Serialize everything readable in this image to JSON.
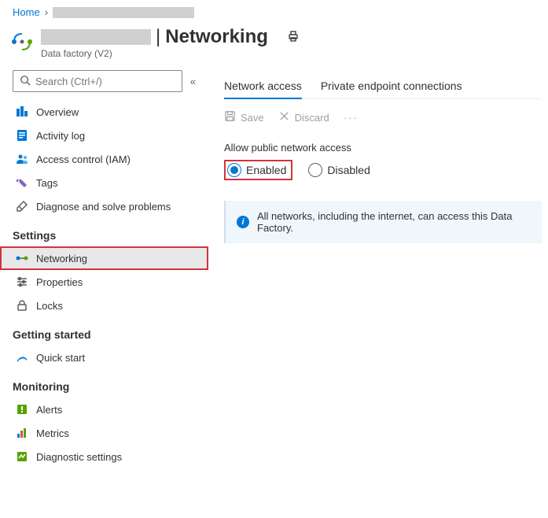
{
  "breadcrumb": {
    "home": "Home"
  },
  "header": {
    "title": "Networking",
    "subtitle": "Data factory (V2)"
  },
  "search": {
    "placeholder": "Search (Ctrl+/)"
  },
  "nav": {
    "overview": "Overview",
    "activity_log": "Activity log",
    "access_control": "Access control (IAM)",
    "tags": "Tags",
    "diagnose": "Diagnose and solve problems",
    "section_settings": "Settings",
    "networking": "Networking",
    "properties": "Properties",
    "locks": "Locks",
    "section_getting_started": "Getting started",
    "quick_start": "Quick start",
    "section_monitoring": "Monitoring",
    "alerts": "Alerts",
    "metrics": "Metrics",
    "diagnostic_settings": "Diagnostic settings"
  },
  "tabs": {
    "network_access": "Network access",
    "private_endpoint": "Private endpoint connections"
  },
  "toolbar": {
    "save": "Save",
    "discard": "Discard"
  },
  "content": {
    "allow_label": "Allow public network access",
    "enabled": "Enabled",
    "disabled": "Disabled",
    "info_text": "All networks, including the internet, can access this Data Factory."
  }
}
